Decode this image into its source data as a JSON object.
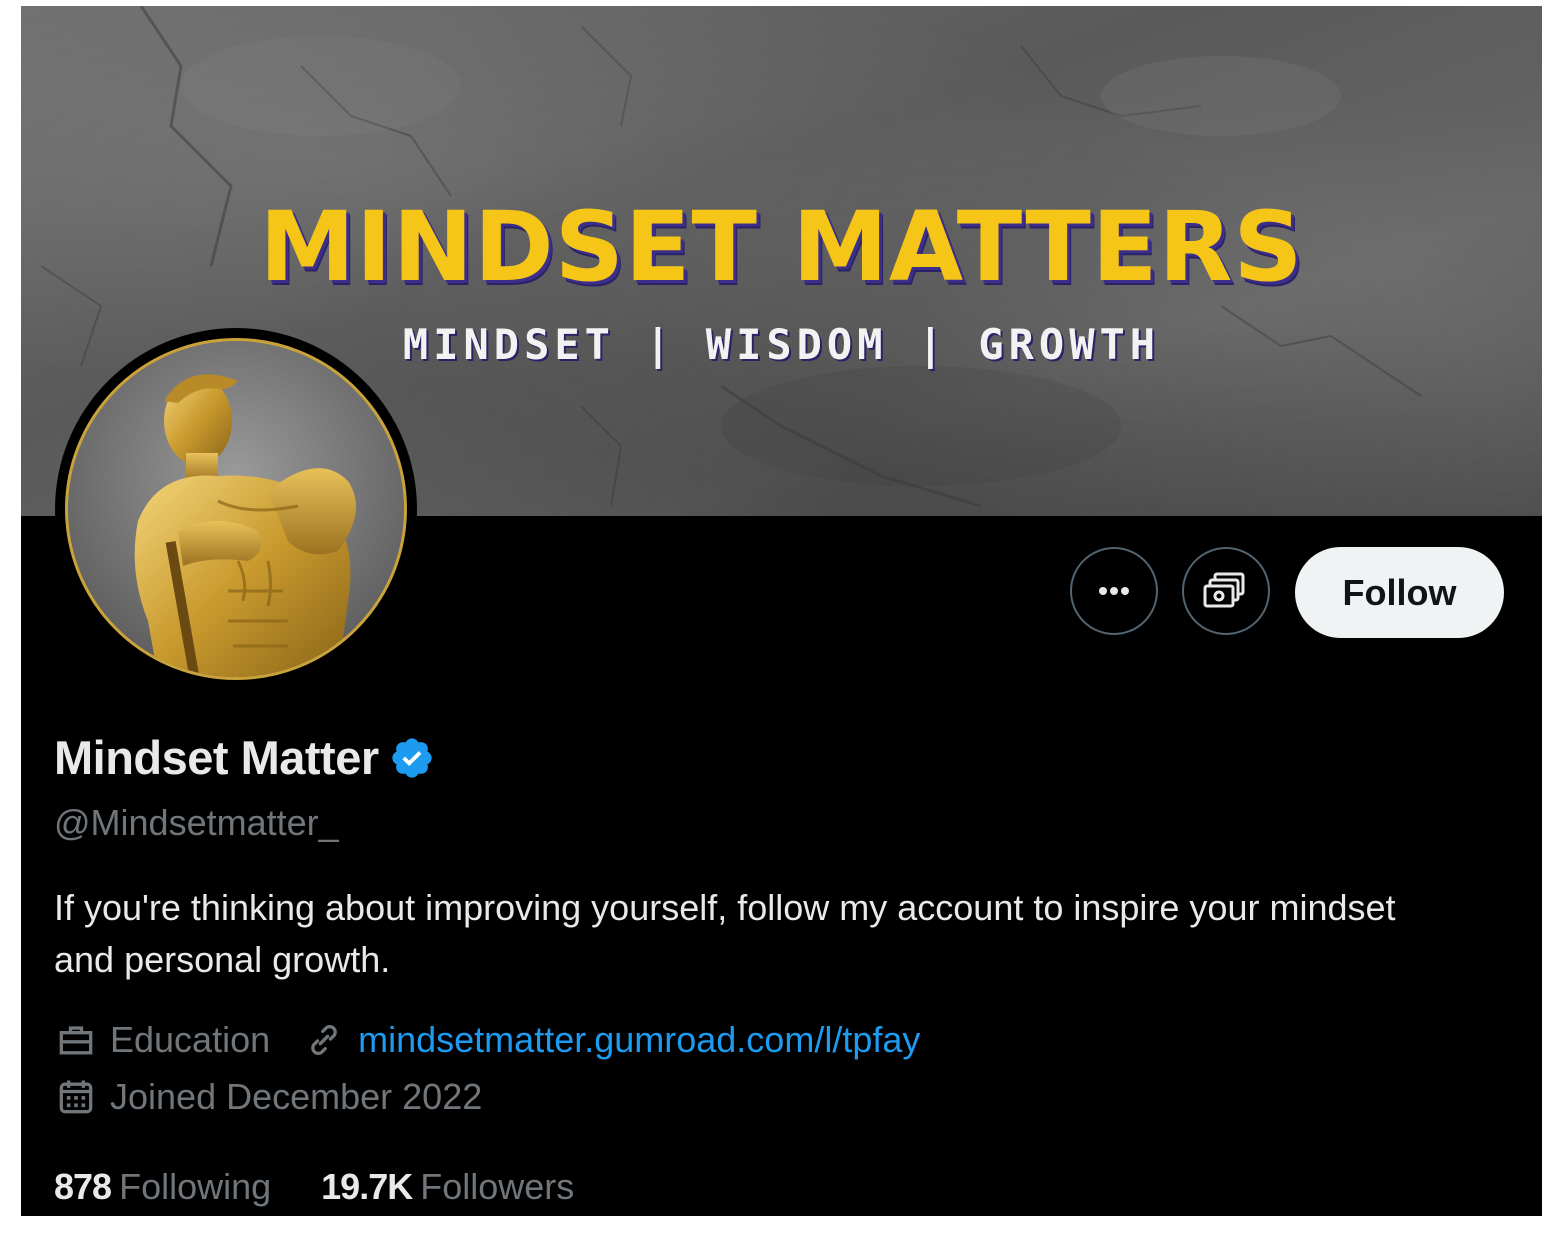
{
  "banner": {
    "title": "MINDSET MATTERS",
    "subtitle": "MINDSET | WISDOM | GROWTH",
    "title_color": "#f5c518"
  },
  "avatar": {
    "description_icon": "golden-statue-avatar",
    "ring_color": "#c9a23a"
  },
  "actions": {
    "more_icon": "more-icon",
    "subscribe_icon": "subscribe-icon",
    "follow_label": "Follow"
  },
  "profile": {
    "display_name": "Mindset Matter",
    "verified": true,
    "verified_color": "#1d9bf0",
    "handle": "@Mindsetmatter_",
    "bio": "If you're thinking about improving yourself, follow my account to inspire your mindset and personal growth.",
    "category": "Education",
    "category_icon": "briefcase-icon",
    "link": "mindsetmatter.gumroad.com/l/tpfay",
    "link_icon": "link-icon",
    "joined": "Joined December 2022",
    "joined_icon": "calendar-icon"
  },
  "stats": {
    "following_count": "878",
    "following_label": "Following",
    "followers_count": "19.7K",
    "followers_label": "Followers"
  },
  "colors": {
    "background": "#000000",
    "text_primary": "#e7e9ea",
    "text_secondary": "#71767b",
    "accent": "#1d9bf0"
  }
}
